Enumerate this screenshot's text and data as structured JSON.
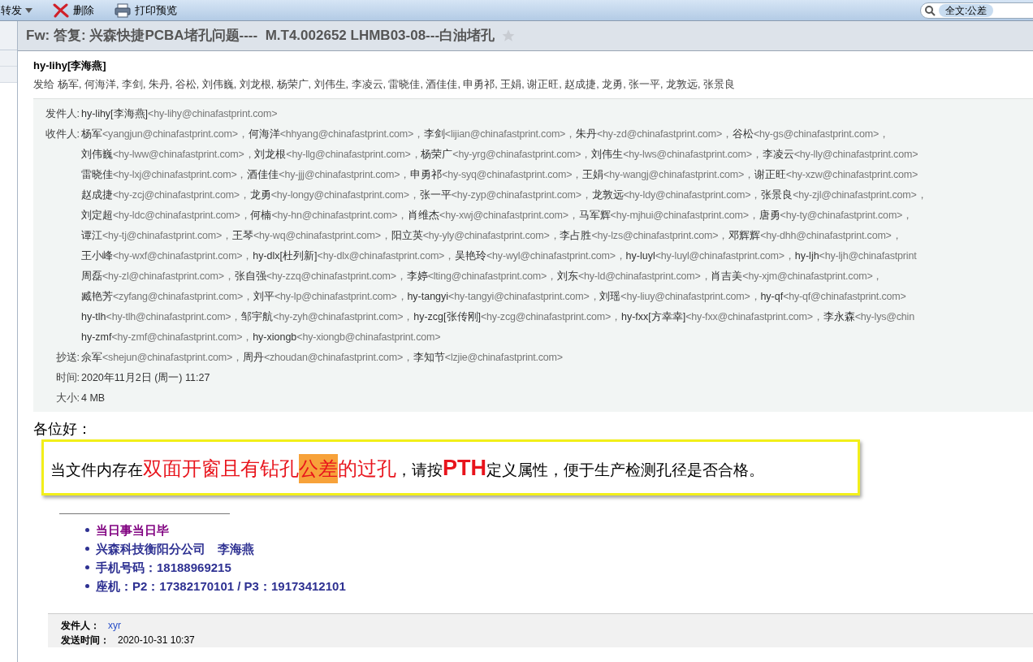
{
  "toolbar": {
    "items": [
      {
        "label": "转发",
        "kind": "dropdown"
      },
      {
        "label": "删除",
        "kind": "delete"
      },
      {
        "label": "打印预览",
        "kind": "print"
      }
    ],
    "search": {
      "value": "全文:公差"
    }
  },
  "message": {
    "subject": "Fw: 答复: 兴森快捷PCBA堵孔问题----  M.T4.002652 LHMB03-08---白油堵孔",
    "starred": false,
    "sender": "hy-lihy[李海燕]",
    "sent_to_label": "发给",
    "sent_to": "杨军, 何海洋, 李剑, 朱丹, 谷松, 刘伟巍, 刘龙根, 杨荣广, 刘伟生, 李凌云, 雷晓佳, 酒佳佳, 申勇祁, 王娟, 谢正旺, 赵成捷, 龙勇, 张一平, 龙敦远, 张景良",
    "details": [
      {
        "label": "发件人:",
        "lines": [
          [
            {
              "name": "hy-lihy[李海燕]",
              "address": "<hy-lihy@chinafastprint.com>"
            }
          ]
        ]
      },
      {
        "label": "收件人:",
        "lines": [
          [
            {
              "name": "杨军",
              "address": "<yangjun@chinafastprint.com>，"
            },
            {
              "name": "何海洋",
              "address": "<hhyang@chinafastprint.com>，"
            },
            {
              "name": "李剑",
              "address": "<lijian@chinafastprint.com>，"
            },
            {
              "name": "朱丹",
              "address": "<hy-zd@chinafastprint.com>，"
            },
            {
              "name": "谷松",
              "address": "<hy-gs@chinafastprint.com>，"
            }
          ],
          [
            {
              "name": "刘伟巍",
              "address": "<hy-lww@chinafastprint.com>，"
            },
            {
              "name": "刘龙根",
              "address": "<hy-llg@chinafastprint.com>，"
            },
            {
              "name": "杨荣广",
              "address": "<hy-yrg@chinafastprint.com>，"
            },
            {
              "name": "刘伟生",
              "address": "<hy-lws@chinafastprint.com>，"
            },
            {
              "name": "李凌云",
              "address": "<hy-lly@chinafastprint.com>"
            }
          ],
          [
            {
              "name": "雷晓佳",
              "address": "<hy-lxj@chinafastprint.com>，"
            },
            {
              "name": "酒佳佳",
              "address": "<hy-jjj@chinafastprint.com>，"
            },
            {
              "name": "申勇祁",
              "address": "<hy-syq@chinafastprint.com>，"
            },
            {
              "name": "王娟",
              "address": "<hy-wangj@chinafastprint.com>，"
            },
            {
              "name": "谢正旺",
              "address": "<hy-xzw@chinafastprint.com>"
            }
          ],
          [
            {
              "name": "赵成捷",
              "address": "<hy-zcj@chinafastprint.com>，"
            },
            {
              "name": "龙勇",
              "address": "<hy-longy@chinafastprint.com>，"
            },
            {
              "name": "张一平",
              "address": "<hy-zyp@chinafastprint.com>，"
            },
            {
              "name": "龙敦远",
              "address": "<hy-ldy@chinafastprint.com>，"
            },
            {
              "name": "张景良",
              "address": "<hy-zjl@chinafastprint.com>，"
            }
          ],
          [
            {
              "name": "刘定超",
              "address": "<hy-ldc@chinafastprint.com>，"
            },
            {
              "name": "何楠",
              "address": "<hy-hn@chinafastprint.com>，"
            },
            {
              "name": "肖维杰",
              "address": "<hy-xwj@chinafastprint.com>，"
            },
            {
              "name": "马军辉",
              "address": "<hy-mjhui@chinafastprint.com>，"
            },
            {
              "name": "唐勇",
              "address": "<hy-ty@chinafastprint.com>，"
            }
          ],
          [
            {
              "name": "谭江",
              "address": "<hy-tj@chinafastprint.com>，"
            },
            {
              "name": "王琴",
              "address": "<hy-wq@chinafastprint.com>，"
            },
            {
              "name": "阳立英",
              "address": "<hy-yly@chinafastprint.com>，"
            },
            {
              "name": "李占胜",
              "address": "<hy-lzs@chinafastprint.com>，"
            },
            {
              "name": "邓辉辉",
              "address": "<hy-dhh@chinafastprint.com>，"
            }
          ],
          [
            {
              "name": "王小峰",
              "address": "<hy-wxf@chinafastprint.com>，"
            },
            {
              "name": "hy-dlx[杜列新]",
              "address": "<hy-dlx@chinafastprint.com>，"
            },
            {
              "name": "吴艳玲",
              "address": "<hy-wyl@chinafastprint.com>，"
            },
            {
              "name": "hy-luyl",
              "address": "<hy-luyl@chinafastprint.com>，"
            },
            {
              "name": "hy-ljh",
              "address": "<hy-ljh@chinafastprint"
            }
          ],
          [
            {
              "name": "周磊",
              "address": "<hy-zl@chinafastprint.com>，"
            },
            {
              "name": "张自强",
              "address": "<hy-zzq@chinafastprint.com>，"
            },
            {
              "name": "李婷",
              "address": "<lting@chinafastprint.com>，"
            },
            {
              "name": "刘东",
              "address": "<hy-ld@chinafastprint.com>，"
            },
            {
              "name": "肖吉美",
              "address": "<hy-xjm@chinafastprint.com>，"
            }
          ],
          [
            {
              "name": "臧艳芳",
              "address": "<zyfang@chinafastprint.com>，"
            },
            {
              "name": "刘平",
              "address": "<hy-lp@chinafastprint.com>，"
            },
            {
              "name": "hy-tangyi",
              "address": "<hy-tangyi@chinafastprint.com>，"
            },
            {
              "name": "刘瑶",
              "address": "<hy-liuy@chinafastprint.com>，"
            },
            {
              "name": "hy-qf",
              "address": "<hy-qf@chinafastprint.com>"
            }
          ],
          [
            {
              "name": "hy-tlh",
              "address": "<hy-tlh@chinafastprint.com>，"
            },
            {
              "name": "邹宇航",
              "address": "<hy-zyh@chinafastprint.com>，"
            },
            {
              "name": "hy-zcg[张传刚]",
              "address": "<hy-zcg@chinafastprint.com>，"
            },
            {
              "name": "hy-fxx[方幸幸]",
              "address": "<hy-fxx@chinafastprint.com>，"
            },
            {
              "name": "李永森",
              "address": "<hy-lys@chin"
            }
          ],
          [
            {
              "name": "hy-zmf",
              "address": "<hy-zmf@chinafastprint.com>，"
            },
            {
              "name": "hy-xiongb",
              "address": "<hy-xiongb@chinafastprint.com>"
            }
          ]
        ]
      },
      {
        "label": "抄送:",
        "lines": [
          [
            {
              "name": "佘军",
              "address": "<shejun@chinafastprint.com>，"
            },
            {
              "name": "周丹",
              "address": "<zhoudan@chinafastprint.com>，"
            },
            {
              "name": "李知节",
              "address": "<lzjie@chinafastprint.com>"
            }
          ]
        ]
      },
      {
        "label": "时间:",
        "lines": [
          [
            {
              "name": "2020年11月2日 (周一) 11:27"
            }
          ]
        ]
      },
      {
        "label": "大小:",
        "lines": [
          [
            {
              "name": "4 MB"
            }
          ]
        ]
      }
    ]
  },
  "body": {
    "greeting": "各位好：",
    "callout": [
      {
        "text": "当文件内存在",
        "kind": "normal"
      },
      {
        "text": "双面开窗且有钻孔",
        "kind": "emphasis"
      },
      {
        "text": "公差",
        "kind": "highlight"
      },
      {
        "text": "的过孔",
        "kind": "emphasis"
      },
      {
        "text": "，请按",
        "kind": "normal"
      },
      {
        "text": "PTH",
        "kind": "strong"
      },
      {
        "text": "定义属性，便于生产检测孔径是否合格。",
        "kind": "normal"
      }
    ],
    "signature": [
      {
        "text": "当日事当日毕",
        "color": "#800080"
      },
      {
        "text": "兴森科技衡阳分公司　李海燕",
        "color": "#2e3192"
      },
      {
        "text": "手机号码：18188969215",
        "color": "#2e3192"
      },
      {
        "text": "座机：P2：17382170101 / P3：19173412101",
        "color": "#2e3192"
      }
    ]
  },
  "quoted_header": [
    {
      "label": "发件人：",
      "value": "xyr",
      "kind": "link"
    },
    {
      "label": "发送时间：",
      "value": "2020-10-31 10:37",
      "kind": "text"
    }
  ]
}
